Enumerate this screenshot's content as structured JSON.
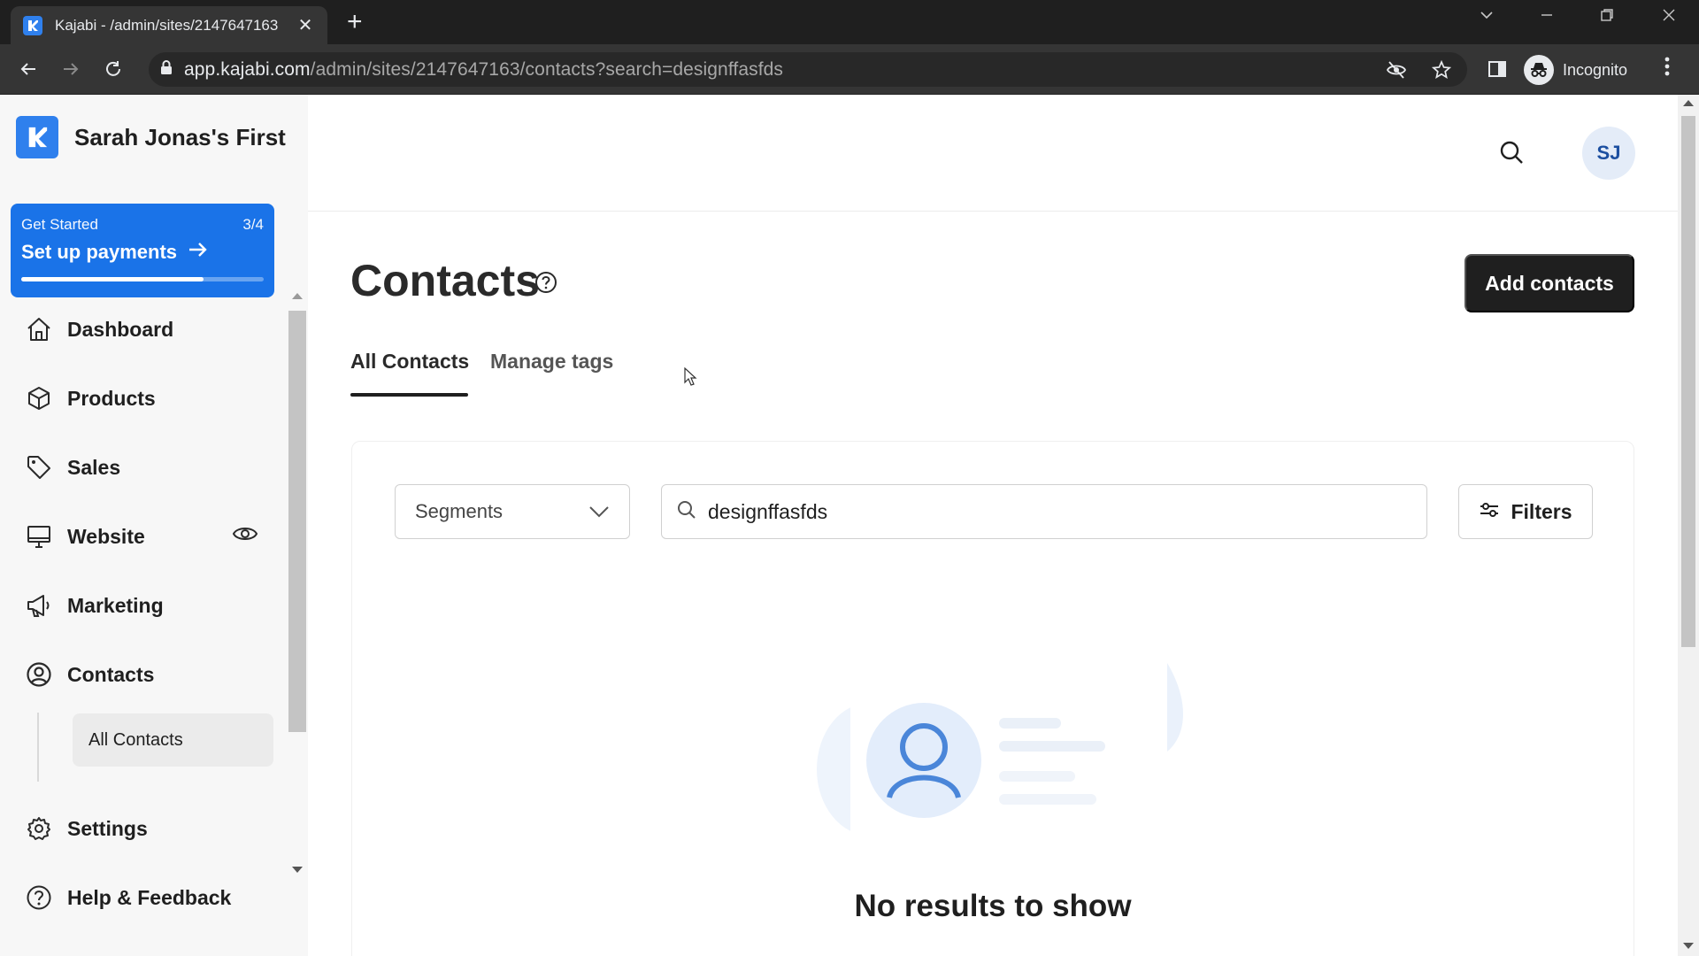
{
  "browser": {
    "tab_title": "Kajabi - /admin/sites/2147647163",
    "tab_close": "✕",
    "new_tab": "+",
    "url_domain": "app.kajabi.com",
    "url_path": "/admin/sites/2147647163/contacts?search=designffasfds",
    "incognito_label": "Incognito"
  },
  "sidebar": {
    "site_name": "Sarah Jonas's First",
    "get_started": {
      "label": "Get Started",
      "progress_text": "3/4",
      "title": "Set up payments",
      "progress": 0.75
    },
    "items": [
      {
        "label": "Dashboard",
        "icon": "home-icon"
      },
      {
        "label": "Products",
        "icon": "box-icon"
      },
      {
        "label": "Sales",
        "icon": "tag-icon"
      },
      {
        "label": "Website",
        "icon": "monitor-icon"
      },
      {
        "label": "Marketing",
        "icon": "megaphone-icon"
      },
      {
        "label": "Contacts",
        "icon": "user-circle-icon"
      },
      {
        "label": "Settings",
        "icon": "gear-icon"
      },
      {
        "label": "Help & Feedback",
        "icon": "help-circle-icon"
      }
    ],
    "sub_items": [
      {
        "label": "All Contacts"
      }
    ]
  },
  "header": {
    "avatar_initials": "SJ"
  },
  "main": {
    "title": "Contacts",
    "add_button": "Add contacts",
    "tabs": [
      {
        "label": "All Contacts",
        "active": true
      },
      {
        "label": "Manage tags",
        "active": false
      }
    ],
    "segments_label": "Segments",
    "search_value": "designffasfds",
    "filters_label": "Filters",
    "empty_message": "No results to show"
  },
  "colors": {
    "brand": "#2f80ed",
    "primary_button": "#1f1f1f",
    "get_started_bg": "#1a73e8"
  }
}
